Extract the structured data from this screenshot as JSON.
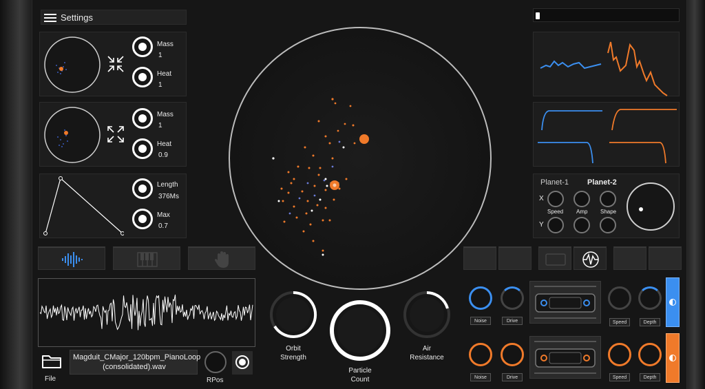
{
  "header": {
    "menu_title": "Settings"
  },
  "planets": [
    {
      "mass_label": "Mass",
      "mass_value": "1",
      "heat_label": "Heat",
      "heat_value": "1"
    },
    {
      "mass_label": "Mass",
      "mass_value": "1",
      "heat_label": "Heat",
      "heat_value": "0.9"
    }
  ],
  "envelope": {
    "length_label": "Length",
    "length_value": "376Ms",
    "max_label": "Max",
    "max_value": "0.7"
  },
  "mod": {
    "planet1_label": "Planet-1",
    "planet2_label": "Planet-2",
    "x_label": "X",
    "y_label": "Y",
    "speed_label": "Speed",
    "amp_label": "Amp",
    "shape_label": "Shape"
  },
  "source_tabs": [
    "waveform-icon",
    "piano-icon",
    "hand-icon"
  ],
  "file": {
    "button_label": "File",
    "filename": "Magduit_CMajor_120bpm_PianoLoop (consolidated).wav",
    "rpos_label": "RPos"
  },
  "main_knobs": {
    "orbit_label": "Orbit Strength",
    "particle_label": "Particle Count",
    "air_label": "Air Resistance"
  },
  "fx": {
    "row1": {
      "noise": "Noise",
      "drive": "Drive",
      "speed": "Speed",
      "depth": "Depth"
    },
    "row2": {
      "noise": "Noise",
      "drive": "Drive",
      "speed": "Speed",
      "depth": "Depth"
    }
  },
  "colors": {
    "accent_blue": "#3b8ff0",
    "accent_orange": "#f07a2a",
    "panel": "#1d1d1d"
  }
}
